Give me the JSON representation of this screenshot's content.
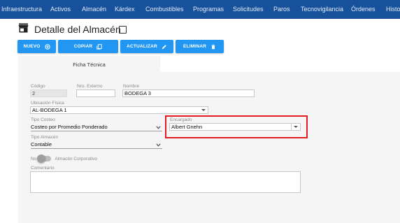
{
  "nav": {
    "items": [
      "Infraestructura",
      "Activos",
      "Almacén",
      "Kárdex",
      "Combustibles",
      "Programas",
      "Solicitudes",
      "Paros",
      "Tecnovigilancia",
      "Órdenes",
      "Histo"
    ]
  },
  "header": {
    "icon": "store-icon",
    "title": "Detalle del Almacén"
  },
  "toolbar": {
    "nuevo_label": "NUEVO",
    "copiar_label": "COPIAR",
    "actualizar_label": "ACTUALIZAR",
    "eliminar_label": "ELIMINAR"
  },
  "tabs": {
    "active_label": "Ficha Técnica"
  },
  "form": {
    "codigo": {
      "label": "Código",
      "value": "2"
    },
    "nro_externo": {
      "label": "Nro. Externo",
      "value": ""
    },
    "nombre": {
      "label": "Nombre",
      "value": "BODEGA 3"
    },
    "ubicacion": {
      "label": "Ubicación Física",
      "value": "AL-BODEGA 1"
    },
    "tipo_costeo": {
      "label": "Tipo Costeo",
      "value": "Costeo por Promedio Ponderado"
    },
    "encargado": {
      "label": "Encargado",
      "value": "Albert Gnehn"
    },
    "tipo_almacen": {
      "label": "Tipo Almacén",
      "value": "Contable"
    },
    "corporativo": {
      "off_label": "No",
      "on_label": "Almacén Corporativo",
      "checked": false
    },
    "comentario": {
      "label": "Comentario",
      "value": ""
    }
  },
  "colors": {
    "nav_bg": "#17519b",
    "button_bg": "#2196f3",
    "highlight": "#e11d22"
  }
}
